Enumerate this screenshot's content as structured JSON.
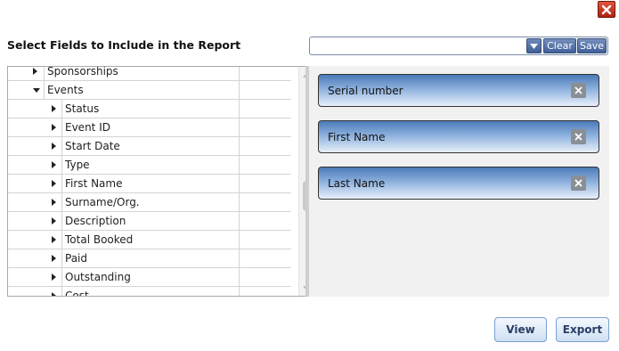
{
  "dialog": {
    "title": "Select Fields to Include in the Report"
  },
  "toolbar": {
    "combo_value": "",
    "clear_label": "Clear",
    "save_label": "Save"
  },
  "tree": {
    "items": [
      {
        "label": "Sponsorships",
        "level": 1,
        "expander": "right"
      },
      {
        "label": "Events",
        "level": 1,
        "expander": "down"
      },
      {
        "label": "Status",
        "level": 2,
        "expander": "right"
      },
      {
        "label": "Event ID",
        "level": 2,
        "expander": "right"
      },
      {
        "label": "Start Date",
        "level": 2,
        "expander": "right"
      },
      {
        "label": "Type",
        "level": 2,
        "expander": "right"
      },
      {
        "label": "First Name",
        "level": 2,
        "expander": "right"
      },
      {
        "label": "Surname/Org.",
        "level": 2,
        "expander": "right"
      },
      {
        "label": "Description",
        "level": 2,
        "expander": "right"
      },
      {
        "label": "Total Booked",
        "level": 2,
        "expander": "right"
      },
      {
        "label": "Paid",
        "level": 2,
        "expander": "right"
      },
      {
        "label": "Outstanding",
        "level": 2,
        "expander": "right"
      },
      {
        "label": "Cost",
        "level": 2,
        "expander": "right"
      }
    ]
  },
  "selected_fields": [
    {
      "label": "Serial number"
    },
    {
      "label": "First Name"
    },
    {
      "label": "Last Name"
    }
  ],
  "footer": {
    "view_label": "View",
    "export_label": "Export"
  },
  "icons": {
    "close": "close-icon",
    "dropdown": "chevron-down-icon",
    "remove": "remove-icon"
  },
  "colors": {
    "accent": "#41609a",
    "close": "#c0301a",
    "field_gradient_top": "#4b7ab8",
    "field_gradient_bottom": "#e8f0fa"
  }
}
